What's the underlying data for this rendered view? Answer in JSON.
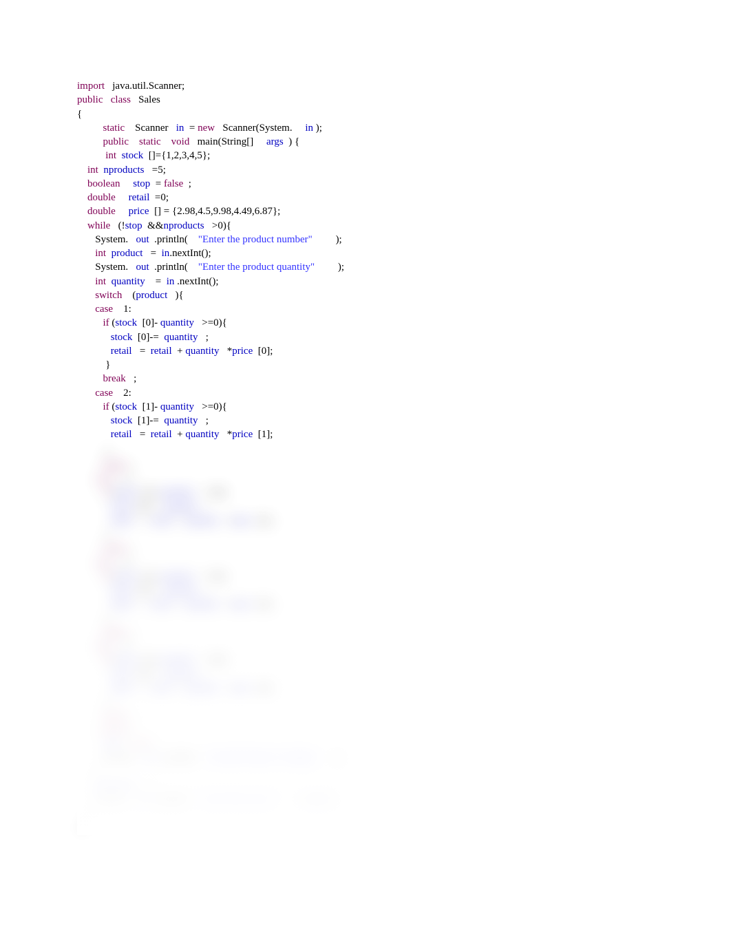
{
  "clear_lines": [
    [
      {
        "cls": "kw",
        "t": "import"
      },
      {
        "cls": "black",
        "t": "   java.util.Scanner;"
      }
    ],
    [
      {
        "cls": "kw",
        "t": "public"
      },
      {
        "cls": "black",
        "t": "   "
      },
      {
        "cls": "kw",
        "t": "class"
      },
      {
        "cls": "black",
        "t": "   Sales"
      }
    ],
    [
      {
        "cls": "black",
        "t": "{"
      }
    ],
    [
      {
        "cls": "black",
        "t": "          "
      },
      {
        "cls": "kw",
        "t": "static"
      },
      {
        "cls": "black",
        "t": "    Scanner   "
      },
      {
        "cls": "var",
        "t": "in"
      },
      {
        "cls": "black",
        "t": "  = "
      },
      {
        "cls": "kw",
        "t": "new"
      },
      {
        "cls": "black",
        "t": "   Scanner(System.     "
      },
      {
        "cls": "var",
        "t": "in"
      },
      {
        "cls": "black",
        "t": " );"
      }
    ],
    [
      {
        "cls": "black",
        "t": "          "
      },
      {
        "cls": "kw",
        "t": "public"
      },
      {
        "cls": "black",
        "t": "    "
      },
      {
        "cls": "kw",
        "t": "static"
      },
      {
        "cls": "black",
        "t": "    "
      },
      {
        "cls": "kw",
        "t": "void"
      },
      {
        "cls": "black",
        "t": "   main(String[]     "
      },
      {
        "cls": "var",
        "t": "args"
      },
      {
        "cls": "black",
        "t": "  ) {"
      }
    ],
    [
      {
        "cls": "black",
        "t": ""
      }
    ],
    [
      {
        "cls": "black",
        "t": "           "
      },
      {
        "cls": "kw",
        "t": "int"
      },
      {
        "cls": "black",
        "t": "  "
      },
      {
        "cls": "var",
        "t": "stock"
      },
      {
        "cls": "black",
        "t": "  []={1,2,3,4,5};"
      }
    ],
    [
      {
        "cls": "black",
        "t": "    "
      },
      {
        "cls": "kw",
        "t": "int"
      },
      {
        "cls": "black",
        "t": "  "
      },
      {
        "cls": "var",
        "t": "nproducts"
      },
      {
        "cls": "black",
        "t": "   =5;"
      }
    ],
    [
      {
        "cls": "black",
        "t": "    "
      },
      {
        "cls": "kw",
        "t": "boolean"
      },
      {
        "cls": "black",
        "t": "     "
      },
      {
        "cls": "var",
        "t": "stop"
      },
      {
        "cls": "black",
        "t": "  = "
      },
      {
        "cls": "kw",
        "t": "false"
      },
      {
        "cls": "black",
        "t": "  ;"
      }
    ],
    [
      {
        "cls": "black",
        "t": "    "
      },
      {
        "cls": "kw",
        "t": "double"
      },
      {
        "cls": "black",
        "t": "     "
      },
      {
        "cls": "var",
        "t": "retail"
      },
      {
        "cls": "black",
        "t": "  =0;"
      }
    ],
    [
      {
        "cls": "black",
        "t": "    "
      },
      {
        "cls": "kw",
        "t": "double"
      },
      {
        "cls": "black",
        "t": "     "
      },
      {
        "cls": "var",
        "t": "price"
      },
      {
        "cls": "black",
        "t": "  [] = {2.98,4.5,9.98,4.49,6.87};"
      }
    ],
    [
      {
        "cls": "black",
        "t": "    "
      },
      {
        "cls": "kw",
        "t": "while"
      },
      {
        "cls": "black",
        "t": "   (!"
      },
      {
        "cls": "var",
        "t": "stop"
      },
      {
        "cls": "black",
        "t": "  &&"
      },
      {
        "cls": "var",
        "t": "nproducts"
      },
      {
        "cls": "black",
        "t": "   >0){"
      }
    ],
    [
      {
        "cls": "black",
        "t": "       System.   "
      },
      {
        "cls": "var",
        "t": "out"
      },
      {
        "cls": "black",
        "t": "  .println(    "
      },
      {
        "cls": "str",
        "t": "\"Enter the product number\""
      },
      {
        "cls": "black",
        "t": "         );"
      }
    ],
    [
      {
        "cls": "black",
        "t": "       "
      },
      {
        "cls": "kw",
        "t": "int"
      },
      {
        "cls": "black",
        "t": "  "
      },
      {
        "cls": "var",
        "t": "product"
      },
      {
        "cls": "black",
        "t": "   =  "
      },
      {
        "cls": "var",
        "t": "in"
      },
      {
        "cls": "black",
        "t": ".nextInt();"
      }
    ],
    [
      {
        "cls": "black",
        "t": "       System.   "
      },
      {
        "cls": "var",
        "t": "out"
      },
      {
        "cls": "black",
        "t": "  .println(    "
      },
      {
        "cls": "str",
        "t": "\"Enter the product quantity\""
      },
      {
        "cls": "black",
        "t": "         );"
      }
    ],
    [
      {
        "cls": "black",
        "t": "       "
      },
      {
        "cls": "kw",
        "t": "int"
      },
      {
        "cls": "black",
        "t": "  "
      },
      {
        "cls": "var",
        "t": "quantity"
      },
      {
        "cls": "black",
        "t": "    =  "
      },
      {
        "cls": "var",
        "t": "in"
      },
      {
        "cls": "black",
        "t": " .nextInt();"
      }
    ],
    [
      {
        "cls": "black",
        "t": "       "
      },
      {
        "cls": "kw",
        "t": "switch"
      },
      {
        "cls": "black",
        "t": "    ("
      },
      {
        "cls": "var",
        "t": "product"
      },
      {
        "cls": "black",
        "t": "   ){"
      }
    ],
    [
      {
        "cls": "black",
        "t": "       "
      },
      {
        "cls": "kw",
        "t": "case"
      },
      {
        "cls": "black",
        "t": "    1:"
      }
    ],
    [
      {
        "cls": "black",
        "t": "          "
      },
      {
        "cls": "kw",
        "t": "if"
      },
      {
        "cls": "black",
        "t": " ("
      },
      {
        "cls": "var",
        "t": "stock"
      },
      {
        "cls": "black",
        "t": "  [0]- "
      },
      {
        "cls": "var",
        "t": "quantity"
      },
      {
        "cls": "black",
        "t": "   >=0){"
      }
    ],
    [
      {
        "cls": "black",
        "t": "             "
      },
      {
        "cls": "var",
        "t": "stock"
      },
      {
        "cls": "black",
        "t": "  [0]-=  "
      },
      {
        "cls": "var",
        "t": "quantity"
      },
      {
        "cls": "black",
        "t": "   ;"
      }
    ],
    [
      {
        "cls": "black",
        "t": "             "
      },
      {
        "cls": "var",
        "t": "retail"
      },
      {
        "cls": "black",
        "t": "   =  "
      },
      {
        "cls": "var",
        "t": "retail"
      },
      {
        "cls": "black",
        "t": "  + "
      },
      {
        "cls": "var",
        "t": "quantity"
      },
      {
        "cls": "black",
        "t": "   *"
      },
      {
        "cls": "var",
        "t": "price"
      },
      {
        "cls": "black",
        "t": "  [0];"
      }
    ],
    [
      {
        "cls": "black",
        "t": "           }"
      }
    ],
    [
      {
        "cls": "black",
        "t": "          "
      },
      {
        "cls": "kw",
        "t": "break"
      },
      {
        "cls": "black",
        "t": "   ;"
      }
    ],
    [
      {
        "cls": "black",
        "t": "       "
      },
      {
        "cls": "kw",
        "t": "case"
      },
      {
        "cls": "black",
        "t": "    2:"
      }
    ],
    [
      {
        "cls": "black",
        "t": "          "
      },
      {
        "cls": "kw",
        "t": "if"
      },
      {
        "cls": "black",
        "t": " ("
      },
      {
        "cls": "var",
        "t": "stock"
      },
      {
        "cls": "black",
        "t": "  [1]- "
      },
      {
        "cls": "var",
        "t": "quantity"
      },
      {
        "cls": "black",
        "t": "   >=0){"
      }
    ],
    [
      {
        "cls": "black",
        "t": "             "
      },
      {
        "cls": "var",
        "t": "stock"
      },
      {
        "cls": "black",
        "t": "  [1]-=  "
      },
      {
        "cls": "var",
        "t": "quantity"
      },
      {
        "cls": "black",
        "t": "   ;"
      }
    ],
    [
      {
        "cls": "black",
        "t": "             "
      },
      {
        "cls": "var",
        "t": "retail"
      },
      {
        "cls": "black",
        "t": "   =  "
      },
      {
        "cls": "var",
        "t": "retail"
      },
      {
        "cls": "black",
        "t": "  + "
      },
      {
        "cls": "var",
        "t": "quantity"
      },
      {
        "cls": "black",
        "t": "   *"
      },
      {
        "cls": "var",
        "t": "price"
      },
      {
        "cls": "black",
        "t": "  [1];"
      }
    ]
  ],
  "blurred_lines": [
    [
      {
        "cls": "black",
        "t": "           }"
      }
    ],
    [
      {
        "cls": "black",
        "t": "          "
      },
      {
        "cls": "kw",
        "t": "break"
      },
      {
        "cls": "black",
        "t": "   ;"
      }
    ],
    [
      {
        "cls": "black",
        "t": "       "
      },
      {
        "cls": "kw",
        "t": "case"
      },
      {
        "cls": "black",
        "t": "    3:"
      }
    ],
    [
      {
        "cls": "black",
        "t": "          "
      },
      {
        "cls": "kw",
        "t": "if"
      },
      {
        "cls": "black",
        "t": " ("
      },
      {
        "cls": "var",
        "t": "stock"
      },
      {
        "cls": "black",
        "t": "  [2]- "
      },
      {
        "cls": "var",
        "t": "quantity"
      },
      {
        "cls": "black",
        "t": "   >=0){"
      }
    ],
    [
      {
        "cls": "black",
        "t": "             "
      },
      {
        "cls": "var",
        "t": "stock"
      },
      {
        "cls": "black",
        "t": "  [2]-=  "
      },
      {
        "cls": "var",
        "t": "quantity"
      },
      {
        "cls": "black",
        "t": "   ;"
      }
    ],
    [
      {
        "cls": "black",
        "t": "             "
      },
      {
        "cls": "var",
        "t": "retail"
      },
      {
        "cls": "black",
        "t": "   =  "
      },
      {
        "cls": "var",
        "t": "retail"
      },
      {
        "cls": "black",
        "t": "  + "
      },
      {
        "cls": "var",
        "t": "quantity"
      },
      {
        "cls": "black",
        "t": "   *"
      },
      {
        "cls": "var",
        "t": "price"
      },
      {
        "cls": "black",
        "t": "  [2];"
      }
    ],
    [
      {
        "cls": "black",
        "t": "           }"
      }
    ],
    [
      {
        "cls": "black",
        "t": "          "
      },
      {
        "cls": "kw",
        "t": "break"
      },
      {
        "cls": "black",
        "t": "   ;"
      }
    ],
    [
      {
        "cls": "black",
        "t": "       "
      },
      {
        "cls": "kw",
        "t": "case"
      },
      {
        "cls": "black",
        "t": "    4:"
      }
    ],
    [
      {
        "cls": "black",
        "t": "          "
      },
      {
        "cls": "kw",
        "t": "if"
      },
      {
        "cls": "black",
        "t": " ("
      },
      {
        "cls": "var",
        "t": "stock"
      },
      {
        "cls": "black",
        "t": "  [3]- "
      },
      {
        "cls": "var",
        "t": "quantity"
      },
      {
        "cls": "black",
        "t": "   >=0){"
      }
    ],
    [
      {
        "cls": "black",
        "t": "             "
      },
      {
        "cls": "var",
        "t": "stock"
      },
      {
        "cls": "black",
        "t": "  [3]-=  "
      },
      {
        "cls": "var",
        "t": "quantity"
      },
      {
        "cls": "black",
        "t": "   ;"
      }
    ],
    [
      {
        "cls": "black",
        "t": "             "
      },
      {
        "cls": "var",
        "t": "retail"
      },
      {
        "cls": "black",
        "t": "   =  "
      },
      {
        "cls": "var",
        "t": "retail"
      },
      {
        "cls": "black",
        "t": "  + "
      },
      {
        "cls": "var",
        "t": "quantity"
      },
      {
        "cls": "black",
        "t": "   *"
      },
      {
        "cls": "var",
        "t": "price"
      },
      {
        "cls": "black",
        "t": "  [3];"
      }
    ],
    [
      {
        "cls": "black",
        "t": "           }"
      }
    ],
    [
      {
        "cls": "black",
        "t": "          "
      },
      {
        "cls": "kw",
        "t": "break"
      },
      {
        "cls": "black",
        "t": "   ;"
      }
    ],
    [
      {
        "cls": "black",
        "t": "       "
      },
      {
        "cls": "kw",
        "t": "case"
      },
      {
        "cls": "black",
        "t": "    5:"
      }
    ],
    [
      {
        "cls": "black",
        "t": "          "
      },
      {
        "cls": "kw",
        "t": "if"
      },
      {
        "cls": "black",
        "t": " ("
      },
      {
        "cls": "var",
        "t": "stock"
      },
      {
        "cls": "black",
        "t": "  [4]- "
      },
      {
        "cls": "var",
        "t": "quantity"
      },
      {
        "cls": "black",
        "t": "   >=0){"
      }
    ],
    [
      {
        "cls": "black",
        "t": "             "
      },
      {
        "cls": "var",
        "t": "stock"
      },
      {
        "cls": "black",
        "t": "  [4]-=  "
      },
      {
        "cls": "var",
        "t": "quantity"
      },
      {
        "cls": "black",
        "t": "   ;"
      }
    ],
    [
      {
        "cls": "black",
        "t": "             "
      },
      {
        "cls": "var",
        "t": "retail"
      },
      {
        "cls": "black",
        "t": "   =  "
      },
      {
        "cls": "var",
        "t": "retail"
      },
      {
        "cls": "black",
        "t": "  + "
      },
      {
        "cls": "var",
        "t": "quantity"
      },
      {
        "cls": "black",
        "t": "   *"
      },
      {
        "cls": "var",
        "t": "price"
      },
      {
        "cls": "black",
        "t": "  [4];"
      }
    ],
    [
      {
        "cls": "black",
        "t": "           }"
      }
    ],
    [
      {
        "cls": "black",
        "t": "          "
      },
      {
        "cls": "kw",
        "t": "break"
      },
      {
        "cls": "black",
        "t": "   ;"
      }
    ],
    [
      {
        "cls": "black",
        "t": "         "
      },
      {
        "cls": "kw",
        "t": "default"
      },
      {
        "cls": "black",
        "t": "  :"
      }
    ],
    [
      {
        "cls": "black",
        "t": "          "
      },
      {
        "cls": "var",
        "t": "stop"
      },
      {
        "cls": "black",
        "t": "  = "
      },
      {
        "cls": "kw",
        "t": "true"
      },
      {
        "cls": "black",
        "t": " ;"
      }
    ],
    [
      {
        "cls": "black",
        "t": "          System.   "
      },
      {
        "cls": "var",
        "t": "out"
      },
      {
        "cls": "black",
        "t": "  .println(    "
      },
      {
        "cls": "str",
        "t": "\"Invalid Product # ending\""
      },
      {
        "cls": "black",
        "t": "       );"
      }
    ],
    [
      {
        "cls": "black",
        "t": "       }"
      }
    ],
    [
      {
        "cls": "black",
        "t": "       "
      },
      {
        "cls": "var",
        "t": "nproducts"
      },
      {
        "cls": "black",
        "t": "    --;"
      }
    ],
    [
      {
        "cls": "black",
        "t": "       System.   "
      },
      {
        "cls": "var",
        "t": "out"
      },
      {
        "cls": "black",
        "t": "  .println(    "
      },
      {
        "cls": "str",
        "t": "\"Total Retail Sale \""
      },
      {
        "cls": "black",
        "t": "       + "
      },
      {
        "cls": "var",
        "t": "retail"
      },
      {
        "cls": "black",
        "t": " );"
      }
    ],
    [
      {
        "cls": "black",
        "t": "    }"
      }
    ],
    [
      {
        "cls": "black",
        "t": " }"
      }
    ]
  ]
}
